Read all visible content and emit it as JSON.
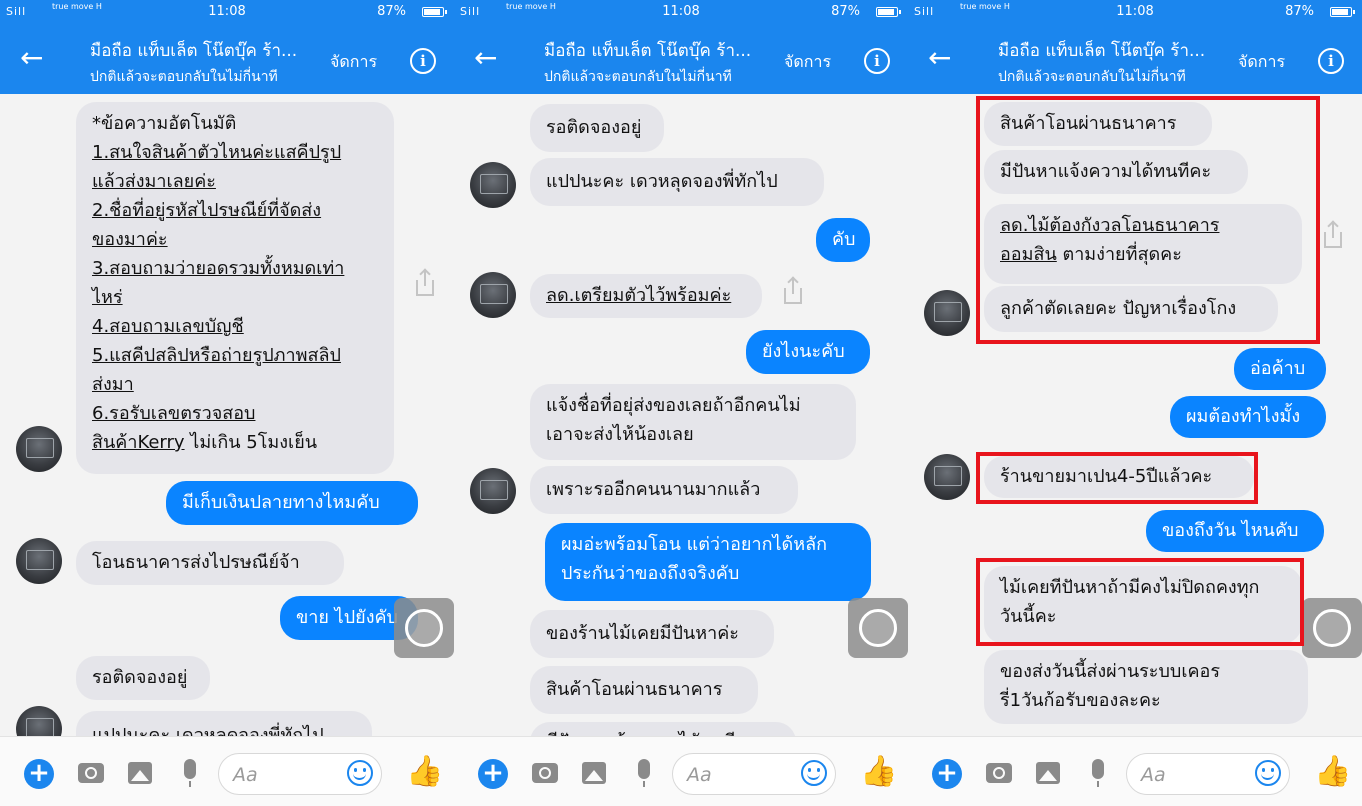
{
  "status_bar": {
    "signal": "Sill",
    "carrier": "true move H",
    "time": "11:08",
    "battery": "87%"
  },
  "header": {
    "title": "มือถือ แท็บเล็ต โน๊ตบุ๊ค ร้า...",
    "subtitle": "ปกติแล้วจะตอบกลับในไม่กี่นาที",
    "manage_label": "จัดการ",
    "back_icon": "←",
    "info_icon": "i"
  },
  "composer": {
    "placeholder": "Aa",
    "plus_icon": "+",
    "like_icon": "👍"
  },
  "panels": [
    {
      "messages": [
        {
          "dir": "in",
          "lines": [
            {
              "t": "*ข้อความอัตโนมัติ",
              "u": false
            },
            {
              "t": "1.สนใจสินค้าตัวไหนค่ะแสคีปรูป",
              "u": true
            },
            {
              "t": "แล้วส่งมาเลยค่ะ",
              "u": true
            },
            {
              "t": "2.ชื่อที่อยู่รหัสไปรษณีย์ที่จัดส่ง",
              "u": true
            },
            {
              "t": "ของมาค่ะ",
              "u": true
            },
            {
              "t": "3.สอบถามว่ายอดรวมทั้งหมดเท่า",
              "u": true
            },
            {
              "t": "ไหร่",
              "u": true
            },
            {
              "t": "4.สอบถามเลขบัญชี",
              "u": true
            },
            {
              "t": "5.แสคีปสลิปหรือถ่ายรูปภาพสลิป",
              "u": true
            },
            {
              "t": "ส่งมา",
              "u": true
            },
            {
              "t": "6.รอรับเลขตรวจสอบ",
              "u": true
            },
            {
              "t": "สินค้าKerry ไม่เกิน 5โมงเย็น",
              "u": "partial",
              "ut": "สินค้าKerry",
              "rest": " ไม่เกิน 5โมงเย็น"
            }
          ]
        },
        {
          "dir": "out",
          "lines": [
            {
              "t": "มีเก็บเงินปลายทางไหมคับ"
            }
          ]
        },
        {
          "dir": "in",
          "lines": [
            {
              "t": "โอนธนาคารส่งไปรษณีย์จ้า"
            }
          ]
        },
        {
          "dir": "out",
          "lines": [
            {
              "t": "ขาย ไปยังคับ"
            }
          ]
        },
        {
          "dir": "in",
          "lines": [
            {
              "t": "รอติดจองอยู่"
            }
          ]
        },
        {
          "dir": "in",
          "lines": [
            {
              "t": "แปปนะคะ  เดวหลุดจองพี่ทักไป"
            }
          ]
        }
      ]
    },
    {
      "messages": [
        {
          "dir": "in",
          "lines": [
            {
              "t": "รอติดจองอยู่"
            }
          ]
        },
        {
          "dir": "in",
          "lines": [
            {
              "t": "แปปนะคะ  เดวหลุดจองพี่ทักไป"
            }
          ]
        },
        {
          "dir": "out",
          "lines": [
            {
              "t": "คับ"
            }
          ]
        },
        {
          "dir": "in",
          "lines": [
            {
              "t": "ลด.เตรียมตัวไว้พร้อมค่ะ",
              "u": true
            }
          ]
        },
        {
          "dir": "out",
          "lines": [
            {
              "t": "ยังไงนะคับ"
            }
          ]
        },
        {
          "dir": "in",
          "lines": [
            {
              "t": "แจ้งชื่อที่อยุ่ส่งของเลยถ้าอีกคนไม่"
            },
            {
              "t": "เอาจะส่งไห้น้องเลย"
            }
          ]
        },
        {
          "dir": "in",
          "lines": [
            {
              "t": "เพราะรออีกคนนานมากแล้ว"
            }
          ]
        },
        {
          "dir": "out",
          "lines": [
            {
              "t": "ผมอ่ะพร้อมโอน แต่ว่าอยากได้หลัก"
            },
            {
              "t": "ประกันว่าของถึงจริงคับ"
            }
          ]
        },
        {
          "dir": "in",
          "lines": [
            {
              "t": "ของร้านไม้เคยมีปันหาค่ะ"
            }
          ]
        },
        {
          "dir": "in",
          "lines": [
            {
              "t": "สินค้าโอนผ่านธนาคาร"
            }
          ]
        },
        {
          "dir": "in",
          "lines": [
            {
              "t": "มีปันหาแจ้งความไดัทนทีคะ"
            }
          ]
        }
      ]
    },
    {
      "messages": [
        {
          "dir": "in",
          "lines": [
            {
              "t": "สินค้าโอนผ่านธนาคาร"
            }
          ]
        },
        {
          "dir": "in",
          "lines": [
            {
              "t": "มีปันหาแจ้งความได้ทนทีคะ"
            }
          ]
        },
        {
          "dir": "in",
          "lines": [
            {
              "t": "ลด.ไม้ต้องกังวลโอนธนาคาร",
              "u": true
            },
            {
              "t": "ออมสิน ตามง่ายที่สุดคะ",
              "u": "partial",
              "ut": "ออมสิน",
              "rest": " ตามง่ายที่สุดคะ"
            }
          ]
        },
        {
          "dir": "in",
          "lines": [
            {
              "t": "ลูกค้าตัดเลยคะ  ปัญหาเรื่องโกง"
            }
          ]
        },
        {
          "dir": "out",
          "lines": [
            {
              "t": "อ่อค้าบ"
            }
          ]
        },
        {
          "dir": "out",
          "lines": [
            {
              "t": "ผมต้องทำไงมั้ง"
            }
          ]
        },
        {
          "dir": "in",
          "lines": [
            {
              "t": "ร้านขายมาเปน4-5ปีแล้วคะ"
            }
          ]
        },
        {
          "dir": "out",
          "lines": [
            {
              "t": "ของถึงวัน ไหนคับ"
            }
          ]
        },
        {
          "dir": "in",
          "lines": [
            {
              "t": "ไม้เคยทีปันหาถ้ามีคงไม่ปิดถคงทุก"
            },
            {
              "t": "วันนี้คะ"
            }
          ]
        },
        {
          "dir": "in",
          "lines": [
            {
              "t": "ของส่งวันนี้ส่งผ่านระบบเคอร"
            },
            {
              "t": "รี่1วันก้อรับของละคะ"
            }
          ]
        }
      ]
    }
  ]
}
